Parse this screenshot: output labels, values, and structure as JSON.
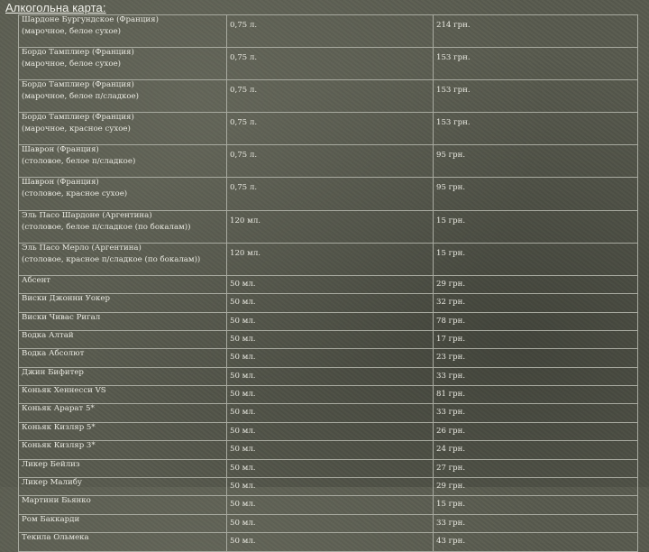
{
  "title": "Алкогольна карта:",
  "items": [
    {
      "name": "Шардоне Бургундское (Франция)",
      "note": "(марочное, белое сухое)",
      "amount": "0,75 л.",
      "price": "214 грн."
    },
    {
      "name": "Бордо Тамплиер (Франция)",
      "note": "(марочное, белое сухое)",
      "amount": "0,75 л.",
      "price": "153 грн."
    },
    {
      "name": "Бордо Тамплиер (Франция)",
      "note": "(марочное, белое п/сладкое)",
      "amount": "0,75 л.",
      "price": "153 грн."
    },
    {
      "name": "Бордо Тамплиер (Франция)",
      "note": "(марочное, красное сухое)",
      "amount": "0,75 л.",
      "price": "153 грн."
    },
    {
      "name": "Шаврон (Франция)",
      "note": "(столовое, белое п/сладкое)",
      "amount": "0,75 л.",
      "price": "95 грн."
    },
    {
      "name": "Шаврон (Франция)",
      "note": "(столовое, красное сухое)",
      "amount": "0,75 л.",
      "price": "95 грн."
    },
    {
      "name": "Эль Пасо Шардоне (Аргентина)",
      "note": "(столовое, белое п/сладкое (по бокалам))",
      "amount": "120 мл.",
      "price": "15 грн."
    },
    {
      "name": "Эль Пасо Мерло (Аргентина)",
      "note": "(столовое, красное п/сладкое (по бокалам))",
      "amount": "120 мл.",
      "price": "15 грн."
    },
    {
      "name": "Абсент",
      "note": "",
      "amount": "50 мл.",
      "price": "29 грн."
    },
    {
      "name": "Виски Джонни Уокер",
      "note": "",
      "amount": "50 мл.",
      "price": "32 грн."
    },
    {
      "name": "Виски Чивас Ригал",
      "note": "",
      "amount": "50 мл.",
      "price": "78 грн."
    },
    {
      "name": "Водка Алтай",
      "note": "",
      "amount": "50 мл.",
      "price": "17 грн."
    },
    {
      "name": "Водка Абсолют",
      "note": "",
      "amount": "50 мл.",
      "price": "23 грн."
    },
    {
      "name": "Джин Бифитер",
      "note": "",
      "amount": "50 мл.",
      "price": "33 грн."
    },
    {
      "name": "Коньяк Хеннесси VS",
      "note": "",
      "amount": "50 мл.",
      "price": "81 грн."
    },
    {
      "name": "Коньяк Арарат 5*",
      "note": "",
      "amount": "50 мл.",
      "price": "33 грн."
    },
    {
      "name": "Коньяк Кизляр 5*",
      "note": "",
      "amount": "50 мл.",
      "price": "26 грн."
    },
    {
      "name": "Коньяк Кизляр 3*",
      "note": "",
      "amount": "50 мл.",
      "price": "24 грн."
    },
    {
      "name": "Ликер Бейлиз",
      "note": "",
      "amount": "50 мл.",
      "price": "27 грн."
    },
    {
      "name": "Ликер Малибу",
      "note": "",
      "amount": "50 мл.",
      "price": "29 грн."
    },
    {
      "name": "Мартини Бьянко",
      "note": "",
      "amount": "50 мл.",
      "price": "15 грн."
    },
    {
      "name": "Ром Баккарди",
      "note": "",
      "amount": "50 мл.",
      "price": "33 грн."
    },
    {
      "name": "Текила Ольмека",
      "note": "",
      "amount": "50 мл.",
      "price": "43 грн."
    }
  ]
}
